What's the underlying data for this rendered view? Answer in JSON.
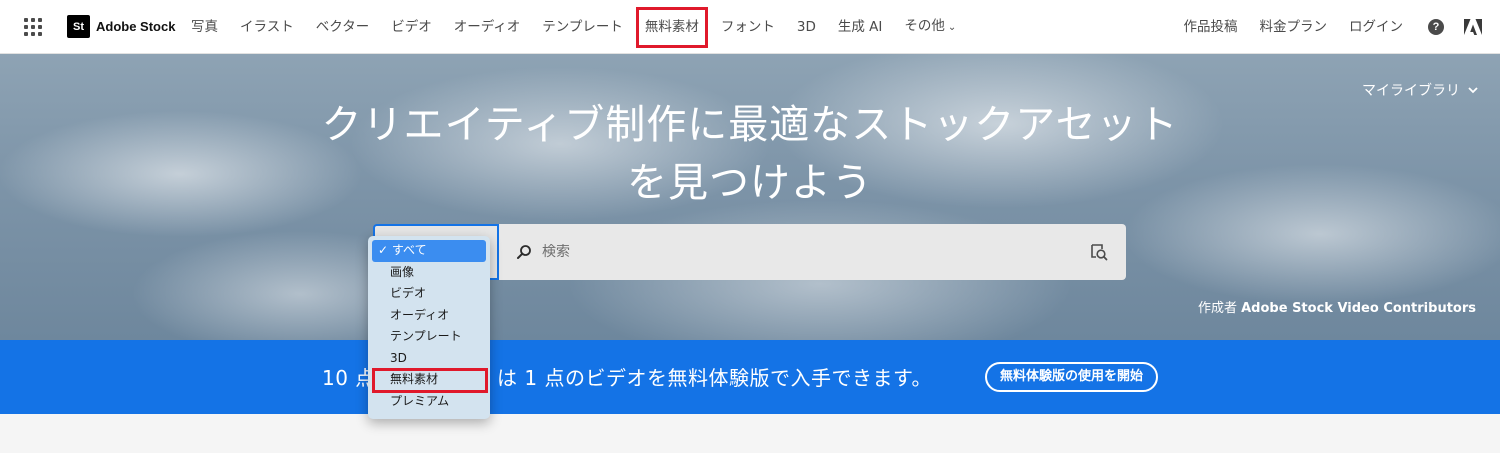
{
  "nav": {
    "brand": "Adobe Stock",
    "brand_mark": "St",
    "links": [
      "写真",
      "イラスト",
      "ベクター",
      "ビデオ",
      "オーディオ",
      "テンプレート",
      "無料素材",
      "フォント",
      "3D",
      "生成 AI",
      "その他"
    ],
    "more_chevron": "⌄",
    "right_links": [
      "作品投稿",
      "料金プラン",
      "ログイン"
    ],
    "help_glyph": "?",
    "highlighted_link": "無料素材"
  },
  "hero": {
    "my_library": "マイライブラリ",
    "title_line1": "クリエイティブ制作に最適なストックアセット",
    "title_line2": "を見つけよう",
    "credit_prefix": "作成者",
    "credit_name": "Adobe Stock Video Contributors"
  },
  "search": {
    "placeholder": "検索",
    "category_options": [
      "すべて",
      "画像",
      "ビデオ",
      "オーディオ",
      "テンプレート",
      "3D",
      "無料素材",
      "プレミアム"
    ],
    "selected_option": "すべて",
    "check_glyph": "✓",
    "highlighted_option": "無料素材"
  },
  "banner": {
    "text_start": "10 点",
    "text_end": "は 1 点のビデオを無料体験版で入手できます。",
    "button_label": "無料体験版の使用を開始"
  },
  "colors": {
    "accent_blue": "#1473e6",
    "highlight_red": "#e0192b",
    "selected_blue": "#3b8df0"
  }
}
